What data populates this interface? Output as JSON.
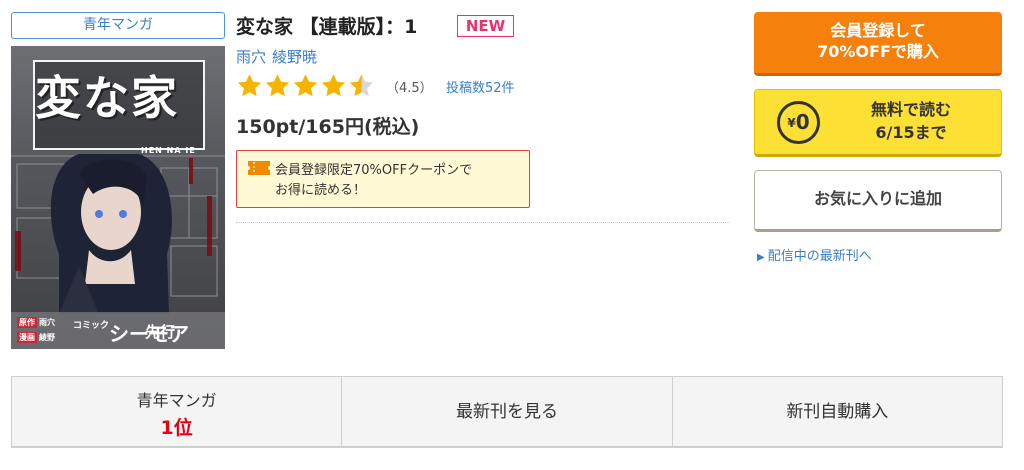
{
  "genre_tag": "青年マンガ",
  "cover": {
    "title": "変な家",
    "subtitle": "HEN NA IE",
    "credit_story_tag": "原作",
    "credit_story": "雨穴",
    "credit_art_tag": "漫画",
    "credit_art": "綾野",
    "brand_small": "コミック",
    "brand": "シーモア",
    "brand_suffix": "先行"
  },
  "book": {
    "title": "変な家 【連載版】：1",
    "new_badge": "NEW",
    "authors": [
      "雨穴",
      "綾野暁"
    ],
    "rating": "（4.5）",
    "rating_value": 4.5,
    "review_count": "投稿数52件",
    "price": "150pt/165円(税込)"
  },
  "coupon": {
    "line1": "会員登録限定70%OFFクーポンで",
    "line2": "お得に読める！"
  },
  "buttons": {
    "member_line1": "会員登録して",
    "member_line2": "70%OFFで購入",
    "free_yen": "¥",
    "free_zero": "0",
    "free_line1": "無料で読む",
    "free_line2": "6/15まで",
    "favorite": "お気に入りに追加"
  },
  "latest_link": "配信中の最新刊へ",
  "tabs": {
    "rank_genre": "青年マンガ",
    "rank_position": "1位",
    "view_latest": "最新刊を見る",
    "auto_purchase": "新刊自動購入"
  },
  "colors": {
    "accent_orange": "#f5800b",
    "free_yellow": "#fde034",
    "link_blue": "#3a7ec8",
    "star_gold": "#f4b400",
    "rank_red": "#e60012"
  }
}
